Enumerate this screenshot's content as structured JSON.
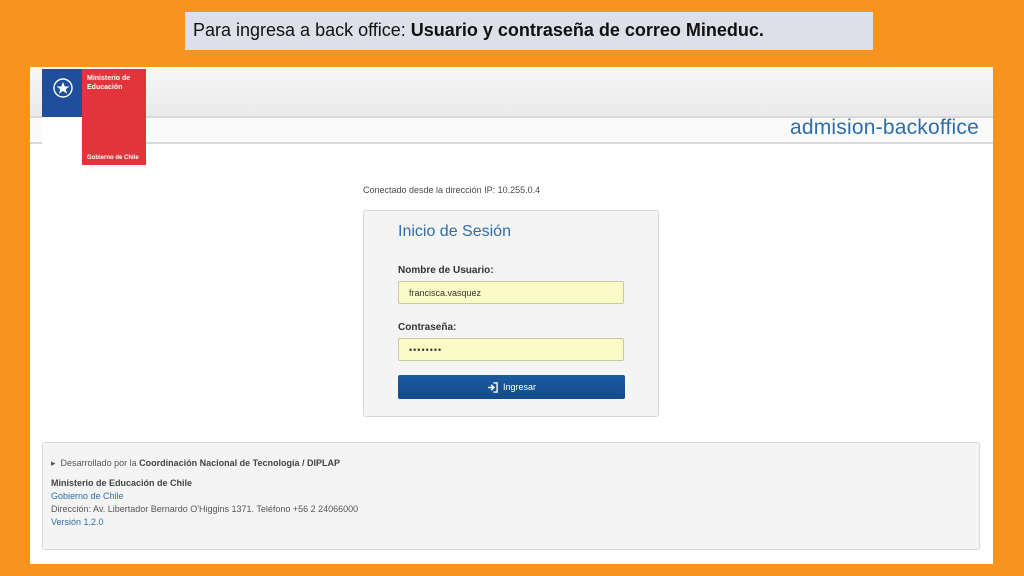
{
  "banner": {
    "prefix": "Para ingresa a back office: ",
    "bold": "Usuario y contraseña de correo Mineduc."
  },
  "header": {
    "logo": {
      "line1": "Ministerio de Educación",
      "line2": "Gobierno de Chile"
    },
    "app_title": "admision-backoffice"
  },
  "ip_notice": "Conectado desde la dirección IP: 10.255.0.4",
  "login": {
    "title": "Inicio de Sesión",
    "username_label": "Nombre de Usuario:",
    "username_value": "francisca.vasquez",
    "password_label": "Contraseña:",
    "password_value": "••••••••",
    "submit_label": "Ingresar",
    "submit_icon": "sign-in-icon"
  },
  "footer": {
    "dev_prefix": "Desarrollado por la ",
    "dev_bold": "Coordinación Nacional de Tecnología / DIPLAP",
    "org": "Ministerio de Educación de Chile",
    "gob_link": "Gobierno de Chile",
    "address": "Dirección: Av. Libertador Bernardo O'Higgins 1371. Teléfono +56 2 24066000",
    "version": "Versión 1.2.0"
  },
  "colors": {
    "background": "#f7941d",
    "accent_blue": "#2f6da7",
    "button_blue": "#1c5aa0",
    "input_yellow": "#fbfbc8",
    "logo_red": "#e1343b",
    "logo_blue": "#1e4e9c"
  }
}
